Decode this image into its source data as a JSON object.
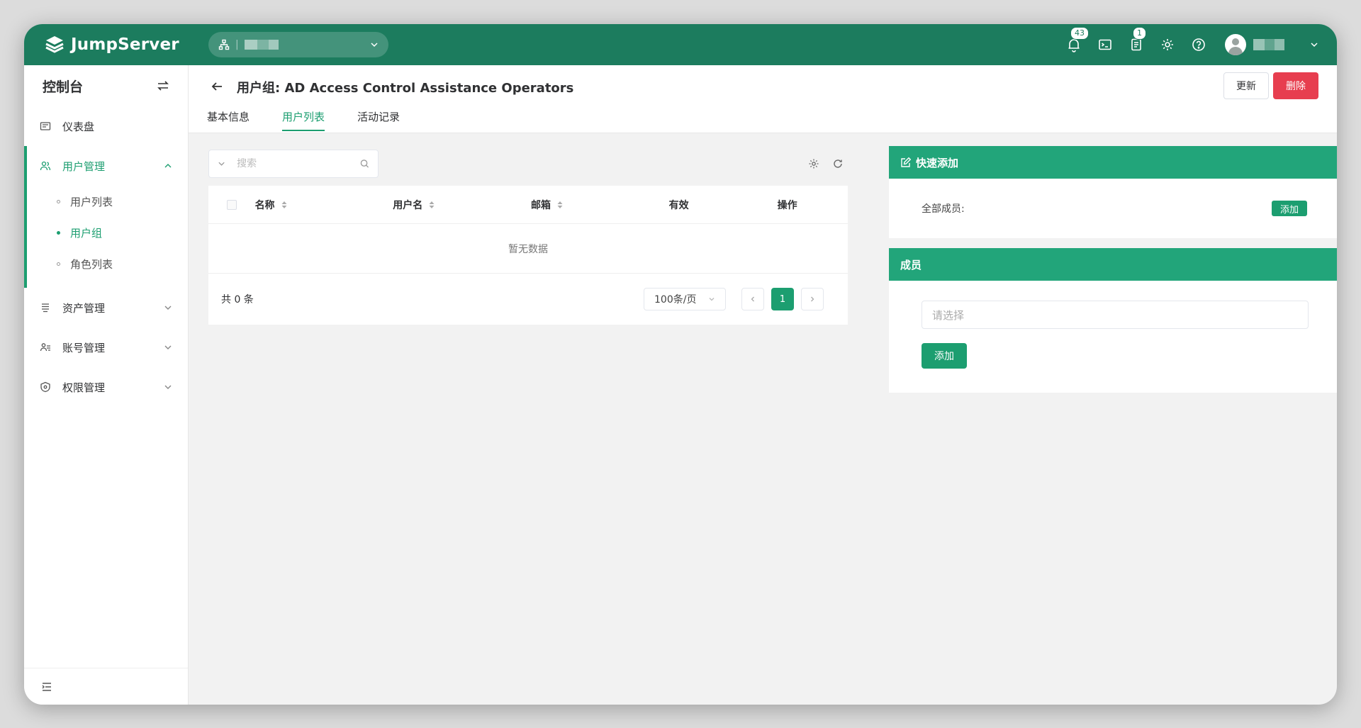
{
  "app": {
    "name": "JumpServer"
  },
  "topbar": {
    "notification_count": "43",
    "ticket_count": "1",
    "icons": [
      "bell-icon",
      "terminal-icon",
      "ticket-icon",
      "gear-icon",
      "help-icon"
    ]
  },
  "sidebar": {
    "title": "控制台",
    "items": [
      {
        "label": "仪表盘",
        "icon": "dashboard-icon"
      },
      {
        "label": "用户管理",
        "icon": "users-icon",
        "expanded": true,
        "children": [
          {
            "label": "用户列表"
          },
          {
            "label": "用户组",
            "active": true
          },
          {
            "label": "角色列表"
          }
        ]
      },
      {
        "label": "资产管理",
        "icon": "assets-icon"
      },
      {
        "label": "账号管理",
        "icon": "accounts-icon"
      },
      {
        "label": "权限管理",
        "icon": "shield-icon"
      }
    ]
  },
  "page": {
    "title": "用户组: AD Access Control Assistance Operators",
    "update_label": "更新",
    "delete_label": "删除",
    "tabs": [
      "基本信息",
      "用户列表",
      "活动记录"
    ],
    "active_tab": "用户列表"
  },
  "table": {
    "search_placeholder": "搜索",
    "columns": [
      "名称",
      "用户名",
      "邮箱",
      "有效",
      "操作"
    ],
    "empty_text": "暂无数据",
    "total_text": "共 0 条",
    "page_size": "100条/页",
    "current_page": "1"
  },
  "quick_add": {
    "title": "快速添加",
    "label": "全部成员:",
    "button": "添加"
  },
  "members": {
    "title": "成员",
    "placeholder": "请选择",
    "button": "添加"
  },
  "colors": {
    "topbar": "#1c7c5e",
    "accent": "#1c9e70",
    "panel_header": "#22a57a",
    "danger": "#e73e4f"
  }
}
